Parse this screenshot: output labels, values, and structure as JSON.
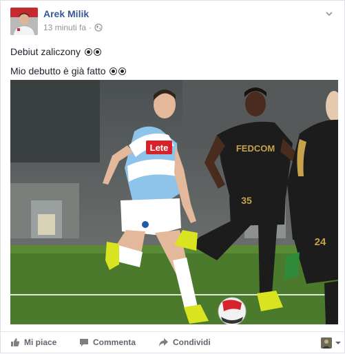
{
  "post": {
    "author": "Arek Milik",
    "time": "13 minuti fa",
    "separator": "·",
    "privacy_icon": "globe-icon",
    "lines": [
      "Debiut zaliczony",
      "Mio debutto è già fatto"
    ],
    "line_icon": "soccer-ball-icon"
  },
  "photo": {
    "shirt_sponsor_left": "Lete",
    "shirt_sponsor_right": "FEDCOM",
    "number_center": "35",
    "number_right": "24"
  },
  "actions": {
    "like": "Mi piace",
    "comment": "Commenta",
    "share": "Condividi"
  },
  "colors": {
    "author": "#365899",
    "meta": "#90949c",
    "action_text": "#616770",
    "napoli_blue": "#8ec4ea",
    "monaco_black": "#1c1c1c",
    "pitch_green": "#4b7a2c"
  }
}
